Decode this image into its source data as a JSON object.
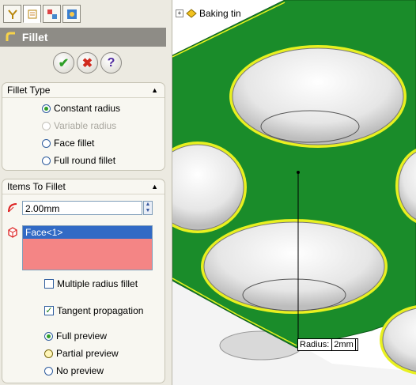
{
  "tabs": [
    {
      "icon": "feature-manager-icon"
    },
    {
      "icon": "property-manager-icon"
    },
    {
      "icon": "configuration-manager-icon"
    },
    {
      "icon": "display-manager-icon"
    }
  ],
  "header": {
    "title": "Fillet"
  },
  "actions": {
    "ok": "✔",
    "cancel": "✖",
    "help": "?"
  },
  "fillet_type": {
    "title": "Fillet Type",
    "options": [
      {
        "label": "Constant radius",
        "selected": true,
        "enabled": true
      },
      {
        "label": "Variable radius",
        "selected": false,
        "enabled": false
      },
      {
        "label": "Face fillet",
        "selected": false,
        "enabled": true
      },
      {
        "label": "Full round fillet",
        "selected": false,
        "enabled": true
      }
    ]
  },
  "items_to_fillet": {
    "title": "Items To Fillet",
    "radius_value": "2.00mm",
    "selected_item": "Face<1>",
    "multiple_radius": {
      "label": "Multiple radius fillet",
      "checked": false
    },
    "tangent": {
      "label": "Tangent propagation",
      "checked": true
    },
    "preview": [
      {
        "label": "Full preview",
        "selected": true
      },
      {
        "label": "Partial preview",
        "selected": false
      },
      {
        "label": "No preview",
        "selected": false
      }
    ]
  },
  "tree": {
    "root": "Baking tin"
  },
  "callout": {
    "label": "Radius:",
    "value": "2mm"
  },
  "colors": {
    "face": "#1a8c2a",
    "edge": "#e8f020",
    "selection": "#f48585",
    "accent": "#316ac5"
  }
}
